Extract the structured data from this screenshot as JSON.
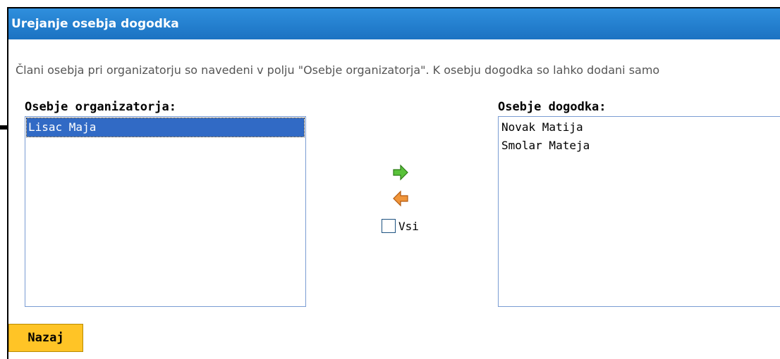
{
  "window": {
    "title": "Urejanje osebja dogodka"
  },
  "description": "Člani osebja pri organizatorju so navedeni v polju \"Osebje organizatorja\". K osebju dogodka so lahko dodani samo",
  "organizer_staff": {
    "label": "Osebje organizatorja:",
    "items": [
      "Lisac Maja"
    ],
    "selected_index": 0
  },
  "event_staff": {
    "label": "Osebje dogodka:",
    "items": [
      "Novak Matija",
      "Smolar Mateja"
    ]
  },
  "controls": {
    "add_icon": "green-right-arrow-icon",
    "remove_icon": "orange-left-arrow-icon",
    "all_checkbox_label": "Vsi",
    "all_checked": false
  },
  "buttons": {
    "back_label": "Nazaj"
  },
  "colors": {
    "title_bar": "#1b72c2",
    "selection": "#316ac5",
    "back_button": "#ffc426",
    "add_arrow": "#4caf2a",
    "remove_arrow": "#e8822a"
  }
}
